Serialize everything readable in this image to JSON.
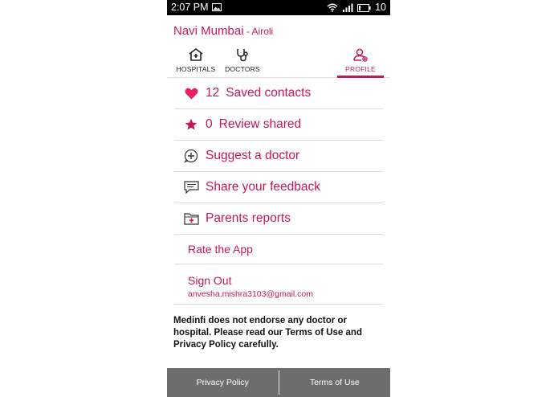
{
  "status_bar": {
    "time": "2:07 PM",
    "battery_level": "10"
  },
  "header": {
    "city": "Navi Mumbai",
    "separator": " - ",
    "area": "Airoli"
  },
  "tabs": [
    {
      "label": "HOSPITALS",
      "icon": "hospital-icon",
      "active": false
    },
    {
      "label": "DOCTORS",
      "icon": "stethoscope-icon",
      "active": false
    },
    {
      "label": "PROFILE",
      "icon": "profile-icon",
      "active": true
    }
  ],
  "menu": {
    "saved": {
      "count": "12",
      "label": "Saved contacts",
      "icon": "heart-icon"
    },
    "review": {
      "count": "0",
      "label": "Review shared",
      "icon": "star-icon"
    },
    "suggest": {
      "label": "Suggest a doctor",
      "icon": "plus-circle-icon"
    },
    "feedback": {
      "label": "Share your feedback",
      "icon": "chat-icon"
    },
    "reports": {
      "label": "Parents reports",
      "icon": "folder-icon"
    },
    "rate": {
      "label": "Rate the App"
    },
    "signout": {
      "label": "Sign Out",
      "email": "anvesha.mishra3103@gmail.com"
    }
  },
  "disclaimer": "Medinfi does not endorse any doctor or hospital. Please read our Terms of Use and Privacy Policy carefully.",
  "footer": {
    "privacy": "Privacy Policy",
    "terms": "Terms of Use"
  },
  "colors": {
    "accent": "#c2185b",
    "footer_bg": "#6d6d6d",
    "status_bg": "#000000"
  }
}
